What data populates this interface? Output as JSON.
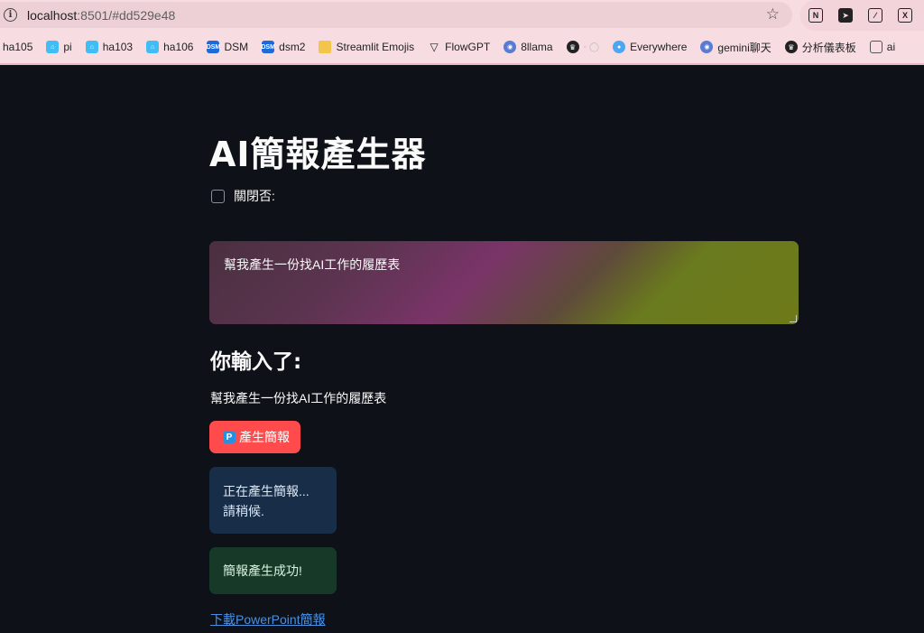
{
  "browser": {
    "url_host": "localhost",
    "url_rest": ":8501/#dd529e48",
    "bookmarks": [
      {
        "label": "ha105",
        "icon": "none"
      },
      {
        "label": "pi",
        "icon": "home-assistant-icon"
      },
      {
        "label": "ha103",
        "icon": "home-assistant-icon"
      },
      {
        "label": "ha106",
        "icon": "home-assistant-icon"
      },
      {
        "label": "DSM",
        "icon": "dsm-icon"
      },
      {
        "label": "dsm2",
        "icon": "dsm-icon"
      },
      {
        "label": "Streamlit Emojis",
        "icon": "folder-icon"
      },
      {
        "label": "FlowGPT",
        "icon": "flowgpt-icon"
      },
      {
        "label": "8llama",
        "icon": "robot-icon"
      },
      {
        "label": "",
        "icon": "crown-icon"
      },
      {
        "label": "Everywhere",
        "icon": "chat-bubble-icon"
      },
      {
        "label": "gemini聊天",
        "icon": "robot-icon"
      },
      {
        "label": "分析儀表板",
        "icon": "crown-icon"
      },
      {
        "label": "ai",
        "icon": "folder-outline-icon"
      }
    ]
  },
  "app": {
    "title": "AI簡報產生器",
    "checkbox_label": "關閉否:",
    "textarea_value": "幫我產生一份找AI工作的履歷表",
    "subheader": "你輸入了:",
    "echo_text": "幫我產生一份找AI工作的履歷表",
    "generate_button_label": "產生簡報",
    "generate_button_icon": "P",
    "info_message_line1": "正在產生簡報...",
    "info_message_line2": "請稍候.",
    "success_message": "簡報產生成功!",
    "download_link_label": "下載PowerPoint簡報"
  }
}
